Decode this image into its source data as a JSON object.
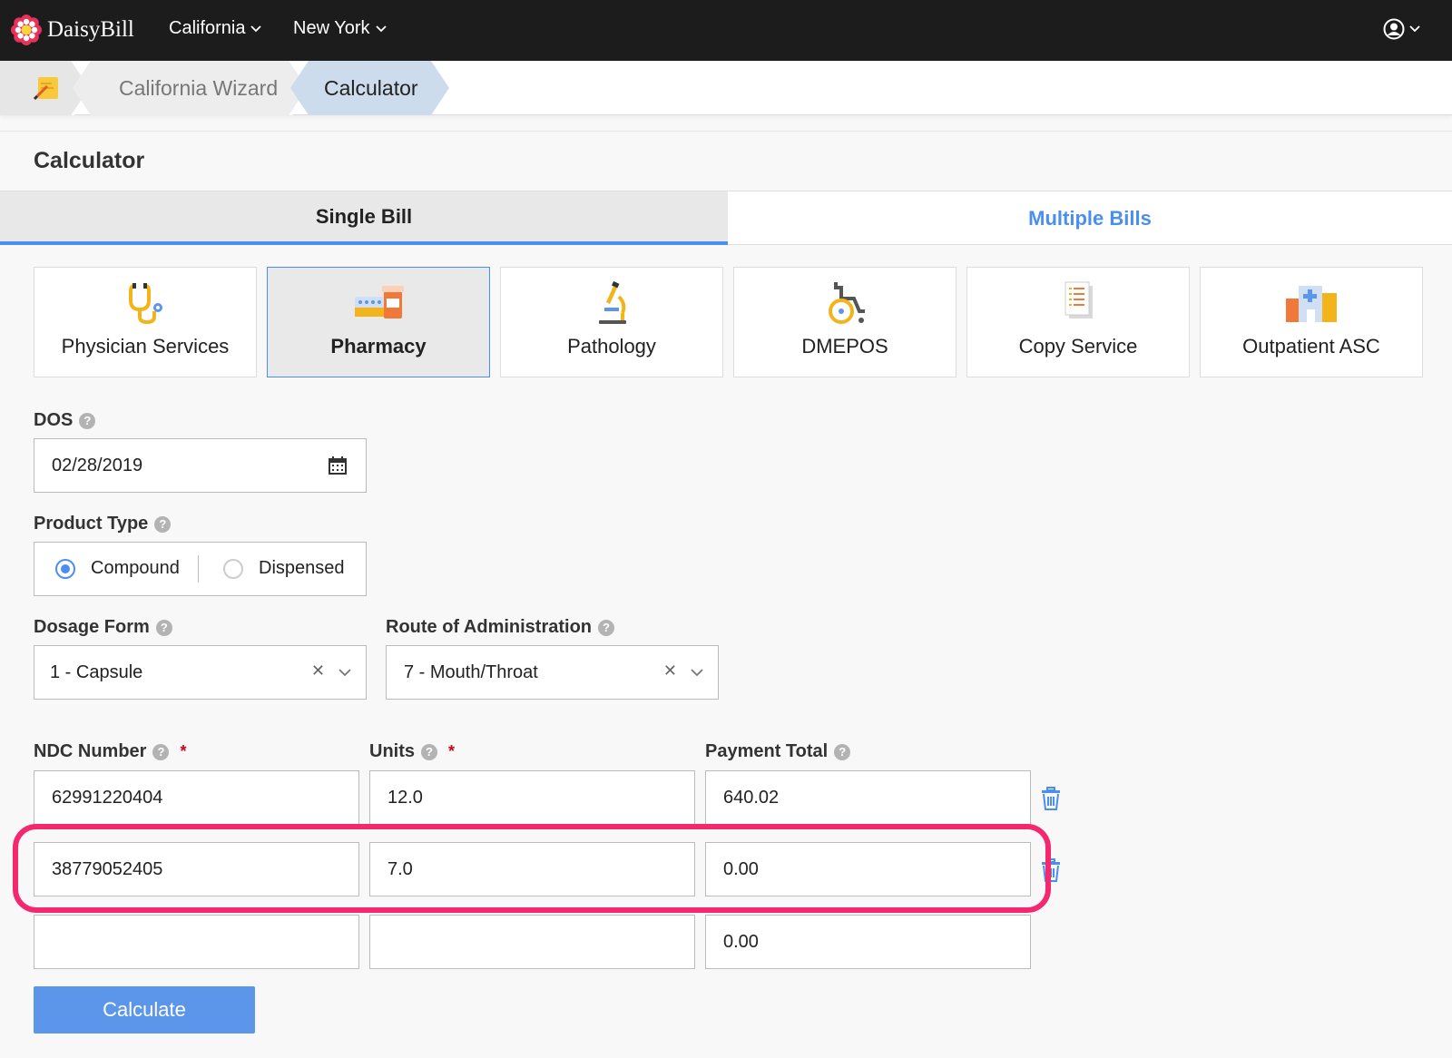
{
  "navbar": {
    "brand": "DaisyBill",
    "menus": [
      "California",
      "New York"
    ]
  },
  "breadcrumb": {
    "items": [
      "California Wizard",
      "Calculator"
    ]
  },
  "page": {
    "title": "Calculator"
  },
  "tabs": [
    "Single Bill",
    "Multiple Bills"
  ],
  "services": [
    {
      "label": "Physician Services",
      "icon": "stethoscope-icon"
    },
    {
      "label": "Pharmacy",
      "icon": "pill-bottle-icon"
    },
    {
      "label": "Pathology",
      "icon": "microscope-icon"
    },
    {
      "label": "DMEPOS",
      "icon": "wheelchair-icon"
    },
    {
      "label": "Copy Service",
      "icon": "document-icon"
    },
    {
      "label": "Outpatient ASC",
      "icon": "hospital-icon"
    }
  ],
  "form": {
    "dos": {
      "label": "DOS",
      "value": "02/28/2019"
    },
    "product_type": {
      "label": "Product Type",
      "options": [
        "Compound",
        "Dispensed"
      ]
    },
    "dosage_form": {
      "label": "Dosage Form",
      "value": "1 - Capsule"
    },
    "route": {
      "label": "Route of Administration",
      "value": "7 - Mouth/Throat"
    },
    "columns": {
      "ndc": "NDC Number",
      "units": "Units",
      "payment": "Payment Total",
      "required": "*"
    },
    "rows": [
      {
        "ndc": "62991220404",
        "units": "12.0",
        "payment": "640.02"
      },
      {
        "ndc": "38779052405",
        "units": "7.0",
        "payment": "0.00"
      },
      {
        "ndc": "",
        "units": "",
        "payment": "0.00"
      }
    ],
    "calculate_label": "Calculate"
  },
  "colors": {
    "accent": "#4a8ef0",
    "highlight": "#f4286f",
    "navbar": "#1c1c1c"
  }
}
